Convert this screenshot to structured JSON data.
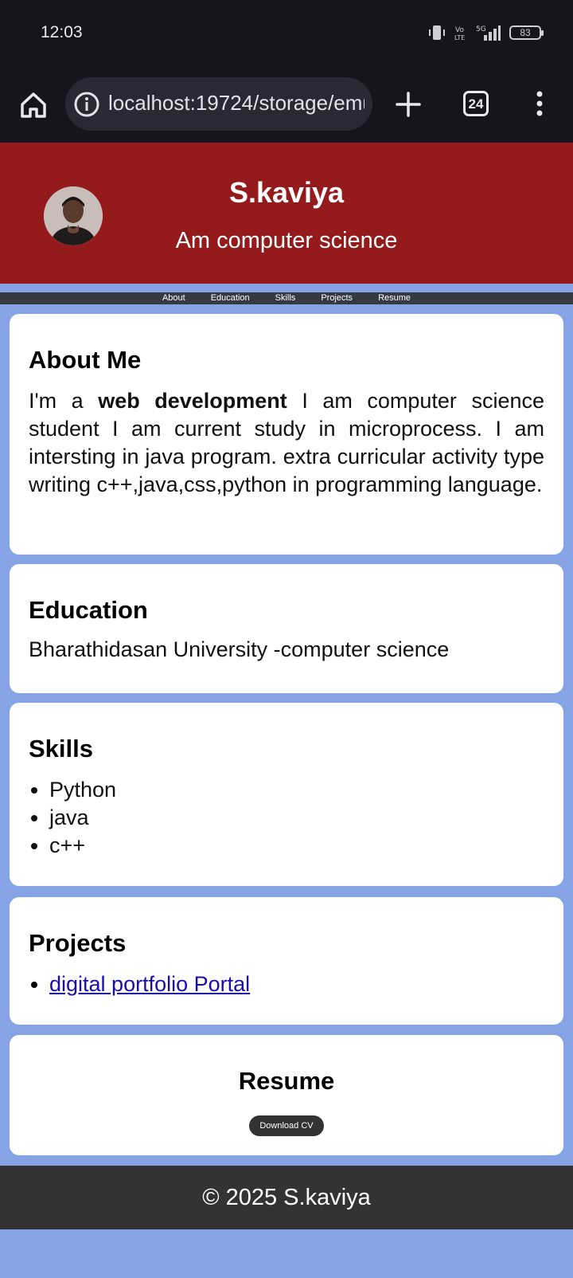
{
  "status_bar": {
    "time": "12:03",
    "battery": "83",
    "icons": [
      "vibrate-icon",
      "volte-icon",
      "5g-signal-icon",
      "battery-icon"
    ]
  },
  "browser": {
    "url": "localhost:19724/storage/emulated",
    "tab_count": "24",
    "icons": [
      "home-icon",
      "info-icon",
      "plus-icon",
      "tabs-icon",
      "more-vert-icon"
    ]
  },
  "header": {
    "name": "S.kaviya",
    "subtitle": "Am computer science",
    "colors": {
      "background": "#941a1c"
    }
  },
  "nav": {
    "items": [
      {
        "label": "About"
      },
      {
        "label": "Education"
      },
      {
        "label": "Skills"
      },
      {
        "label": "Projects"
      },
      {
        "label": "Resume"
      }
    ]
  },
  "about": {
    "title": "About Me",
    "intro": "I'm a",
    "bold": "web development",
    "body": "I am computer science student I am current study in microprocess. I am intersting in java program. extra curricular activity type writing c++,java,css,python in programming language."
  },
  "education": {
    "title": "Education",
    "text": "Bharathidasan University -computer science"
  },
  "skills": {
    "title": "Skills",
    "items": [
      "Python",
      "java",
      "c++"
    ]
  },
  "projects": {
    "title": "Projects",
    "items": [
      {
        "label": "digital portfolio Portal"
      }
    ]
  },
  "resume": {
    "title": "Resume",
    "button": "Download CV"
  },
  "footer": {
    "text": "© 2025 S.kaviya"
  },
  "colors": {
    "page_bg": "#86a3e6",
    "nav_bg": "#343a40",
    "footer_bg": "#333333",
    "link": "#1a0dab"
  }
}
